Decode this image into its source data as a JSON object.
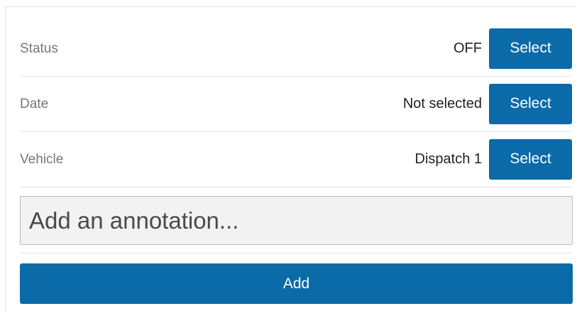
{
  "form": {
    "rows": [
      {
        "label": "Status",
        "value": "OFF",
        "button_label": "Select"
      },
      {
        "label": "Date",
        "value": "Not selected",
        "button_label": "Select"
      },
      {
        "label": "Vehicle",
        "value": "Dispatch 1",
        "button_label": "Select"
      }
    ],
    "annotation": {
      "placeholder": "Add an annotation...",
      "value": ""
    },
    "add_label": "Add"
  },
  "colors": {
    "primary_button": "#0b6aa8",
    "label_text": "#777777",
    "value_text": "#222222",
    "input_background": "#f2f2f2",
    "divider": "#e4e4e4"
  }
}
